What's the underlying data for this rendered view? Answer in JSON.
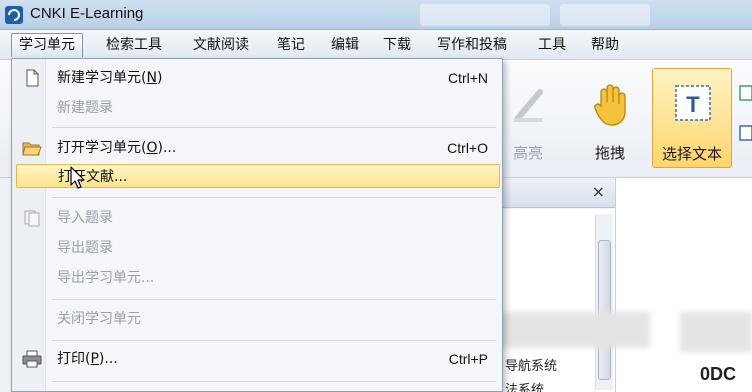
{
  "window": {
    "title": "CNKI E-Learning"
  },
  "menubar": {
    "items": [
      {
        "label": "学习单元",
        "open": true
      },
      {
        "label": "检索工具"
      },
      {
        "label": "文献阅读"
      },
      {
        "label": "笔记"
      },
      {
        "label": "编辑"
      },
      {
        "label": "下载"
      },
      {
        "label": "写作和投稿"
      },
      {
        "label": "工具"
      },
      {
        "label": "帮助"
      }
    ]
  },
  "toolbar": {
    "highlight_label": "高亮",
    "drag_label": "拖拽",
    "select_text_label": "选择文本"
  },
  "dropdown": {
    "new_unit": {
      "label": "新建学习单元(",
      "key": "N",
      "suffix": ")",
      "shortcut": "Ctrl+N"
    },
    "new_record": {
      "label": "新建题录"
    },
    "open_unit": {
      "label": "打开学习单元(",
      "key": "O",
      "suffix": ")...",
      "shortcut": "Ctrl+O"
    },
    "open_doc": {
      "label": "打开文献..."
    },
    "import_records": {
      "label": "导入题录"
    },
    "export_records": {
      "label": "导出题录"
    },
    "export_unit": {
      "label": "导出学习单元..."
    },
    "close_unit": {
      "label": "关闭学习单元"
    },
    "print": {
      "label": "打印(",
      "key": "P",
      "suffix": ")...",
      "shortcut": "Ctrl+P"
    }
  },
  "panel": {
    "close_glyph": "×",
    "line1": "导航系统",
    "line2": "法系统"
  },
  "docview": {
    "fragment": "0DC"
  },
  "colors": {
    "highlight": "#ffe38a",
    "selected_tool": "#ffd56c",
    "menu_border": "#8f9fb5"
  }
}
